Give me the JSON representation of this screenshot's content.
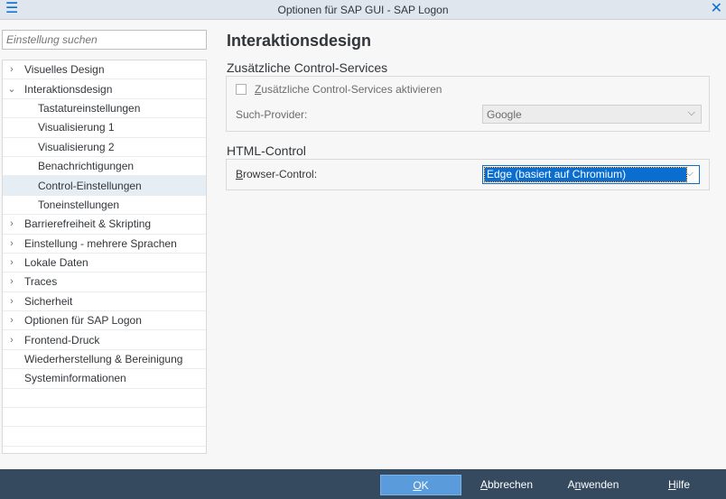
{
  "window": {
    "title": "Optionen für SAP GUI - SAP Logon",
    "menu_icon": "☰",
    "close_icon": "✕"
  },
  "search": {
    "placeholder": "Einstellung suchen"
  },
  "tree": {
    "items": [
      {
        "label": "Visuelles Design",
        "chevron": "›"
      },
      {
        "label": "Interaktionsdesign",
        "chevron": "⌄"
      },
      {
        "label": "Tastatureinstellungen"
      },
      {
        "label": "Visualisierung 1"
      },
      {
        "label": "Visualisierung 2"
      },
      {
        "label": "Benachrichtigungen"
      },
      {
        "label": "Control-Einstellungen"
      },
      {
        "label": "Toneinstellungen"
      },
      {
        "label": "Barrierefreiheit & Skripting",
        "chevron": "›"
      },
      {
        "label": "Einstellung - mehrere Sprachen",
        "chevron": "›"
      },
      {
        "label": "Lokale Daten",
        "chevron": "›"
      },
      {
        "label": "Traces",
        "chevron": "›"
      },
      {
        "label": "Sicherheit",
        "chevron": "›"
      },
      {
        "label": "Optionen für SAP Logon",
        "chevron": "›"
      },
      {
        "label": "Frontend-Druck",
        "chevron": "›"
      },
      {
        "label": "Wiederherstellung & Bereinigung"
      },
      {
        "label": "Systeminformationen"
      }
    ]
  },
  "main": {
    "heading": "Interaktionsdesign",
    "section1": {
      "title": "Zusätzliche Control-Services",
      "checkbox_label_first": "Z",
      "checkbox_label_rest": "usätzliche Control-Services aktivieren",
      "provider_label": "Such-Provider:",
      "provider_value": "Google"
    },
    "section2": {
      "title": "HTML-Control",
      "browser_label_first": "B",
      "browser_label_rest": "rowser-Control:",
      "browser_value": "Edge (basiert auf Chromium)"
    }
  },
  "footer": {
    "ok_first": "O",
    "ok_rest": "K",
    "cancel_first": "A",
    "cancel_rest": "bbrechen",
    "apply_first": "A",
    "apply_mid": "n",
    "apply_rest": "wenden",
    "help_first": "H",
    "help_rest": "ilfe"
  },
  "icons": {
    "chevron_down": "⌵"
  }
}
